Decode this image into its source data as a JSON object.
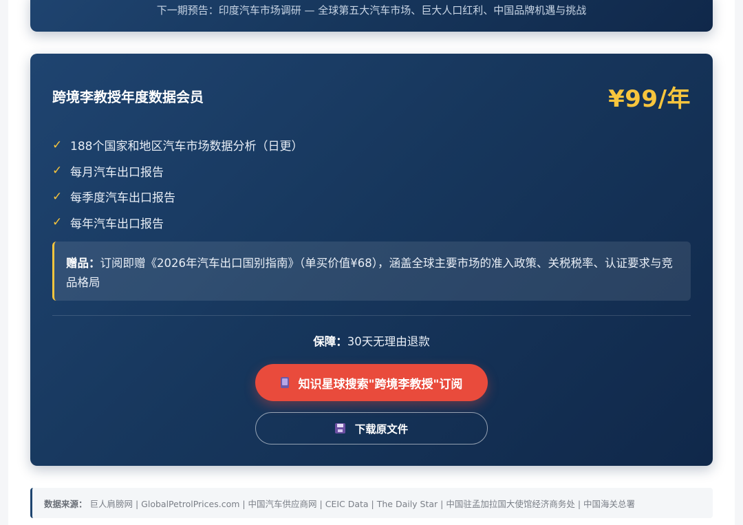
{
  "top_card": {
    "preview_text": "下一期预告：印度汽车市场调研 — 全球第五大汽车市场、巨大人口红利、中国品牌机遇与挑战"
  },
  "membership": {
    "title": "跨境李教授年度数据会员",
    "price": "¥99/年",
    "check_glyph": "✓",
    "features": [
      "188个国家和地区汽车市场数据分析（日更）",
      "每月汽车出口报告",
      "每季度汽车出口报告",
      "每年汽车出口报告"
    ],
    "gift_label": "赠品：",
    "gift_text": "订阅即赠《2026年汽车出口国别指南》（单买价值¥68），涵盖全球主要市场的准入政策、关税税率、认证要求与竞品格局",
    "guarantee_label": "保障：",
    "guarantee_text": "30天无理由退款",
    "subscribe_button": {
      "icon": "phone-icon",
      "label": "知识星球搜索\"跨境李教授\"订阅"
    },
    "download_button": {
      "icon": "floppy-disk-icon",
      "label": "下载原文件"
    }
  },
  "sources": {
    "label": "数据来源：",
    "text": "巨人肩膀网 | GlobalPetrolPrices.com | 中国汽车供应商网 | CEIC Data | The Daily Star | 中国驻孟加拉国大使馆经济商务处 | 中国海关总署"
  },
  "colors": {
    "card_bg": "#17375d",
    "accent_gold": "#f7c53d",
    "cta_red": "#e94b3c"
  }
}
